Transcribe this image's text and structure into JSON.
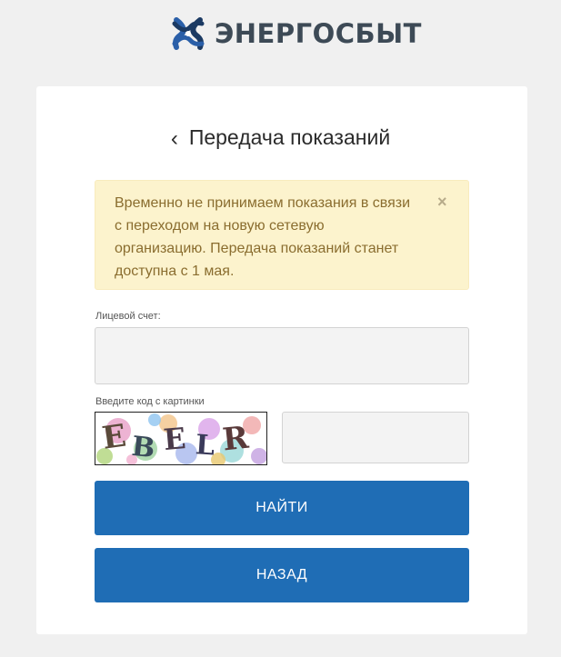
{
  "brand": {
    "name": "ЭНЕРГОСБЫТ",
    "text_color": "#3d4a56",
    "logo_primary_color": "#2a5fa8",
    "logo_secondary_color": "#1b3a63"
  },
  "page": {
    "title": "Передача показаний",
    "back_icon": "chevron-left-icon"
  },
  "alert": {
    "message": "Временно не принимаем показания в связи с переходом на новую сетевую организацию. Передача показаний станет доступна с 1 мая.",
    "close_icon": "close-icon",
    "close_symbol": "×",
    "background": "#fcf3cd",
    "text_color": "#8a6d2f"
  },
  "form": {
    "account_label": "Лицевой счет:",
    "account_value": "",
    "captcha_label": "Введите код с картинки",
    "captcha_value": "",
    "captcha_image": {
      "letters": [
        "E",
        "B",
        "E",
        "L",
        "R"
      ]
    }
  },
  "buttons": {
    "find_label": "НАЙТИ",
    "back_label": "НАЗАД",
    "color": "#1f6db5"
  }
}
